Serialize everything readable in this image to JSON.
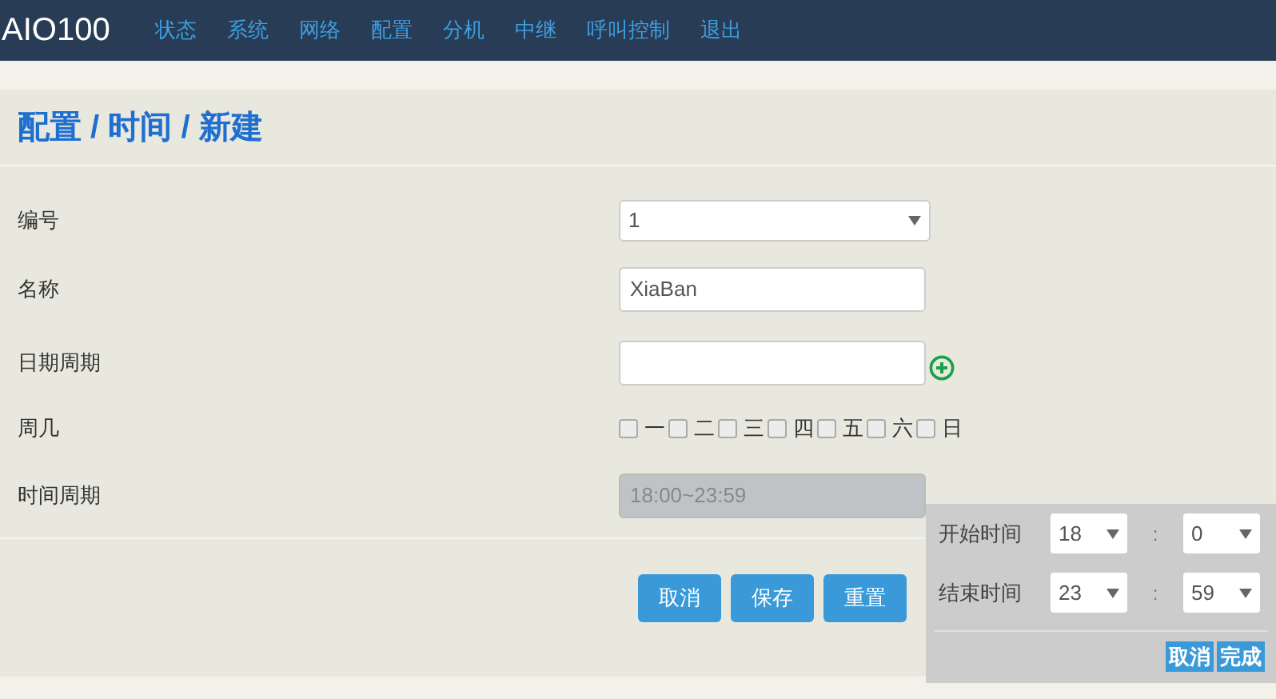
{
  "brand": "AIO100",
  "nav": [
    {
      "label": "状态"
    },
    {
      "label": "系统"
    },
    {
      "label": "网络"
    },
    {
      "label": "配置"
    },
    {
      "label": "分机"
    },
    {
      "label": "中继"
    },
    {
      "label": "呼叫控制"
    },
    {
      "label": "退出"
    }
  ],
  "heading": "配置 / 时间 / 新建",
  "form": {
    "number": {
      "label": "编号",
      "value": "1"
    },
    "name": {
      "label": "名称",
      "value": "XiaBan"
    },
    "date_period": {
      "label": "日期周期"
    },
    "weekdays": {
      "label": "周几",
      "days": [
        {
          "label": "一",
          "checked": false
        },
        {
          "label": "二",
          "checked": false
        },
        {
          "label": "三",
          "checked": false
        },
        {
          "label": "四",
          "checked": false
        },
        {
          "label": "五",
          "checked": false
        },
        {
          "label": "六",
          "checked": false
        },
        {
          "label": "日",
          "checked": false
        }
      ]
    },
    "time_period": {
      "label": "时间周期",
      "value": "18:00~23:59"
    }
  },
  "buttons": [
    "取消",
    "保存",
    "重置"
  ],
  "time_picker": {
    "rows": [
      {
        "label": "开始时间",
        "hour": "18",
        "separator": ":",
        "minute": "0"
      },
      {
        "label": "结束时间",
        "hour": "23",
        "separator": ":",
        "minute": "59"
      }
    ],
    "buttons": [
      "取消",
      "完成"
    ]
  }
}
